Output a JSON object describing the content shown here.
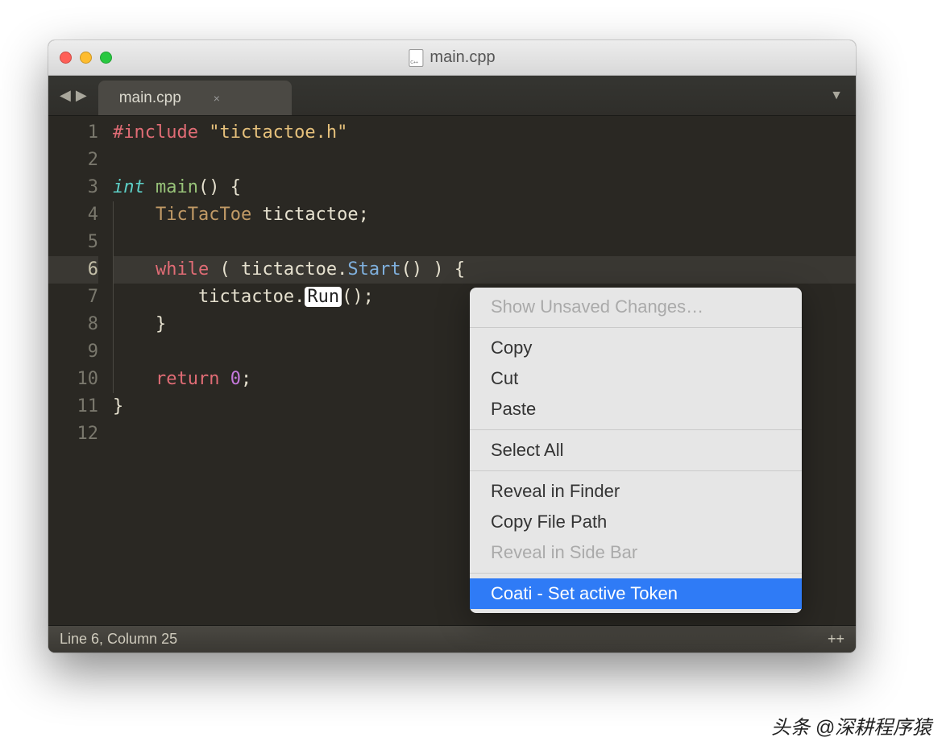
{
  "window": {
    "title": "main.cpp"
  },
  "toolbar": {
    "nav_back": "◀",
    "nav_forward": "▶",
    "dropdown": "▼"
  },
  "tab": {
    "label": "main.cpp",
    "close": "×"
  },
  "code": {
    "lines": [
      {
        "n": "1"
      },
      {
        "n": "2"
      },
      {
        "n": "3"
      },
      {
        "n": "4"
      },
      {
        "n": "5"
      },
      {
        "n": "6"
      },
      {
        "n": "7"
      },
      {
        "n": "8"
      },
      {
        "n": "9"
      },
      {
        "n": "10"
      },
      {
        "n": "11"
      },
      {
        "n": "12"
      }
    ],
    "l1_include": "#include",
    "l1_str": " \"tictactoe.h\"",
    "l3_int": "int",
    "l3_main": " main",
    "l3_rest": "() {",
    "l4_type": "TicTacToe",
    "l4_var": " tictactoe;",
    "l6_while": "while",
    "l6_open": " ( tictactoe.",
    "l6_start": "Start",
    "l6_close": "() ) {",
    "l7_pre": "tictactoe.",
    "l7_run": "Run",
    "l7_post": "();",
    "l8": "}",
    "l10_ret": "return",
    "l10_num": " 0",
    "l10_semi": ";",
    "l11": "}"
  },
  "status": {
    "left": "Line 6, Column 25",
    "right": "++"
  },
  "context_menu": {
    "show_unsaved": "Show Unsaved Changes…",
    "copy": "Copy",
    "cut": "Cut",
    "paste": "Paste",
    "select_all": "Select All",
    "reveal_finder": "Reveal in Finder",
    "copy_path": "Copy File Path",
    "reveal_sidebar": "Reveal in Side Bar",
    "coati": "Coati - Set active Token"
  },
  "watermark": "头条 @深耕程序猿"
}
